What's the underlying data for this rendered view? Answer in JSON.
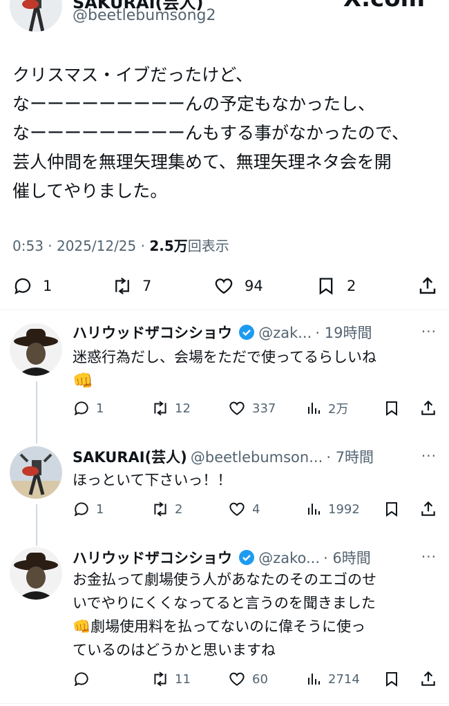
{
  "header": {
    "name": "SAKURAI(芸人)",
    "handle": "@beetlebumsong2",
    "site": "X.com"
  },
  "post": {
    "lines": [
      "クリスマス・イブだったけど、",
      "なーーーーーーーーーんの予定もなかったし、",
      "なーーーーーーーーーんもする事がなかったので、",
      "芸人仲間を無理矢理集めて、無理矢理ネタ会を開",
      "催してやりました。"
    ],
    "time": "0:53 · 2025/12/25 · ",
    "views_num": "2.5万",
    "views_label": "回表示",
    "replies": "1",
    "reposts": "7",
    "likes": "94",
    "bookmarks": "2"
  },
  "replies": [
    {
      "name": "ハリウッドザコシショウ",
      "handle": "@zak...",
      "time": "· 19時間",
      "text": [
        "迷惑行為だし、会場をただで使ってるらしいね"
      ],
      "emoji": "👊",
      "replies": "1",
      "reposts": "12",
      "likes": "337",
      "views": "2万"
    },
    {
      "name": "SAKURAI(芸人)",
      "handle": "@beetlebumson...",
      "time": "· 7時間",
      "text": [
        "ほっといて下さいっ！！"
      ],
      "replies": "1",
      "reposts": "2",
      "likes": "4",
      "views": "1992"
    },
    {
      "name": "ハリウッドザコシショウ",
      "handle": "@zako...",
      "time": "· 6時間",
      "text": [
        "お金払って劇場使う人があなたのそのエゴのせ",
        "いでやりにくくなってると言うのを聞きました",
        "劇場使用料を払ってないのに偉そうに使っ",
        "ているのはどうかと思いますね"
      ],
      "emoji": "👊",
      "replies": "",
      "reposts": "11",
      "likes": "60",
      "views": "2714"
    }
  ],
  "colors": {
    "text": "#0f1419",
    "muted": "#536471",
    "verified": "#1d9bf0"
  }
}
